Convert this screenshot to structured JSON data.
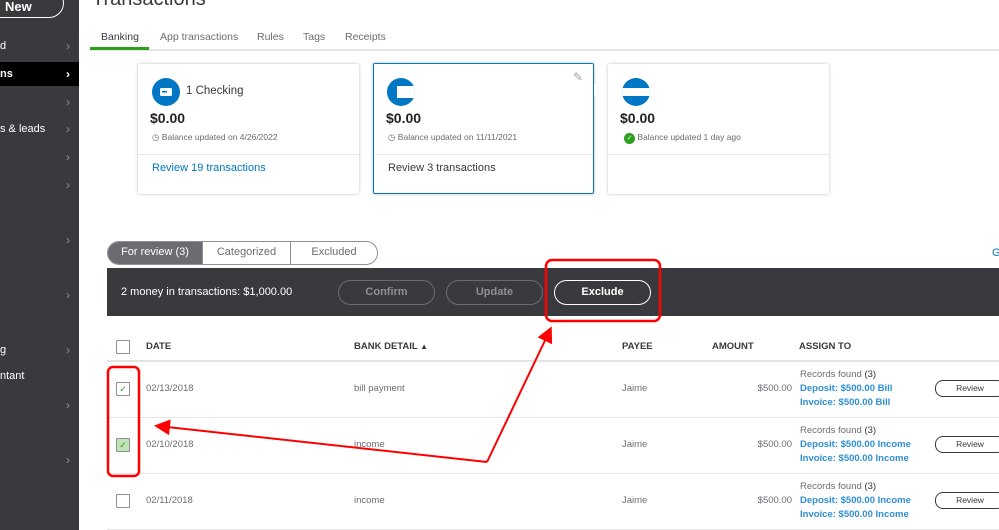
{
  "sidebar": {
    "new_label": "New",
    "items": [
      {
        "label": "d"
      },
      {
        "label": "ns",
        "active": true
      },
      {
        "label": ""
      },
      {
        "label": "s & leads"
      },
      {
        "label": ""
      },
      {
        "label": ""
      },
      {
        "label": ""
      },
      {
        "label": ""
      },
      {
        "label": "g"
      },
      {
        "label": "ntant"
      },
      {
        "label": ""
      },
      {
        "label": ""
      }
    ]
  },
  "header": {
    "title": "Transactions"
  },
  "tabs": [
    "Banking",
    "App transactions",
    "Rules",
    "Tags",
    "Receipts"
  ],
  "cards": [
    {
      "name": "1 Checking",
      "balance": "$0.00",
      "updated": "Balance updated on 4/26/2022",
      "review": "Review 19 transactions"
    },
    {
      "name": "",
      "balance": "$0.00",
      "updated": "Balance updated on 11/11/2021",
      "review": "Review 3 transactions"
    },
    {
      "name": "",
      "balance": "$0.00",
      "updated": "Balance updated 1 day ago",
      "review": ""
    }
  ],
  "review_tabs": [
    "For review (3)",
    "Categorized",
    "Excluded"
  ],
  "right_link": "G",
  "action_bar": {
    "summary": "2 money in transactions: $1,000.00",
    "confirm": "Confirm",
    "update": "Update",
    "exclude": "Exclude"
  },
  "table": {
    "columns": [
      "DATE",
      "BANK DETAIL",
      "PAYEE",
      "AMOUNT",
      "ASSIGN TO"
    ],
    "sort_indicator": "▲",
    "rows": [
      {
        "checked": true,
        "date": "02/13/2018",
        "detail": "bill payment",
        "payee": "Jaime",
        "amount": "$500.00",
        "records": "Records found",
        "count": "(3)",
        "match1": "Deposit: $500.00 Bill",
        "match2": "Invoice: $500.00 Bill",
        "action": "Review"
      },
      {
        "checked": true,
        "date": "02/10/2018",
        "detail": "income",
        "payee": "Jaime",
        "amount": "$500.00",
        "records": "Records found",
        "count": "(3)",
        "match1": "Deposit: $500.00 Income",
        "match2": "Invoice: $500.00 Income",
        "action": "Review"
      },
      {
        "checked": false,
        "date": "02/11/2018",
        "detail": "income",
        "payee": "Jaime",
        "amount": "$500.00",
        "records": "Records found",
        "count": "(3)",
        "match1": "Deposit: $500.00 Income",
        "match2": "Invoice: $500.00 Income",
        "action": "Review"
      }
    ]
  },
  "colors": {
    "brand_green": "#2ca01c",
    "accent_blue": "#0077c5",
    "sidebar": "#393a3d",
    "annotation_red": "#ff0000"
  }
}
